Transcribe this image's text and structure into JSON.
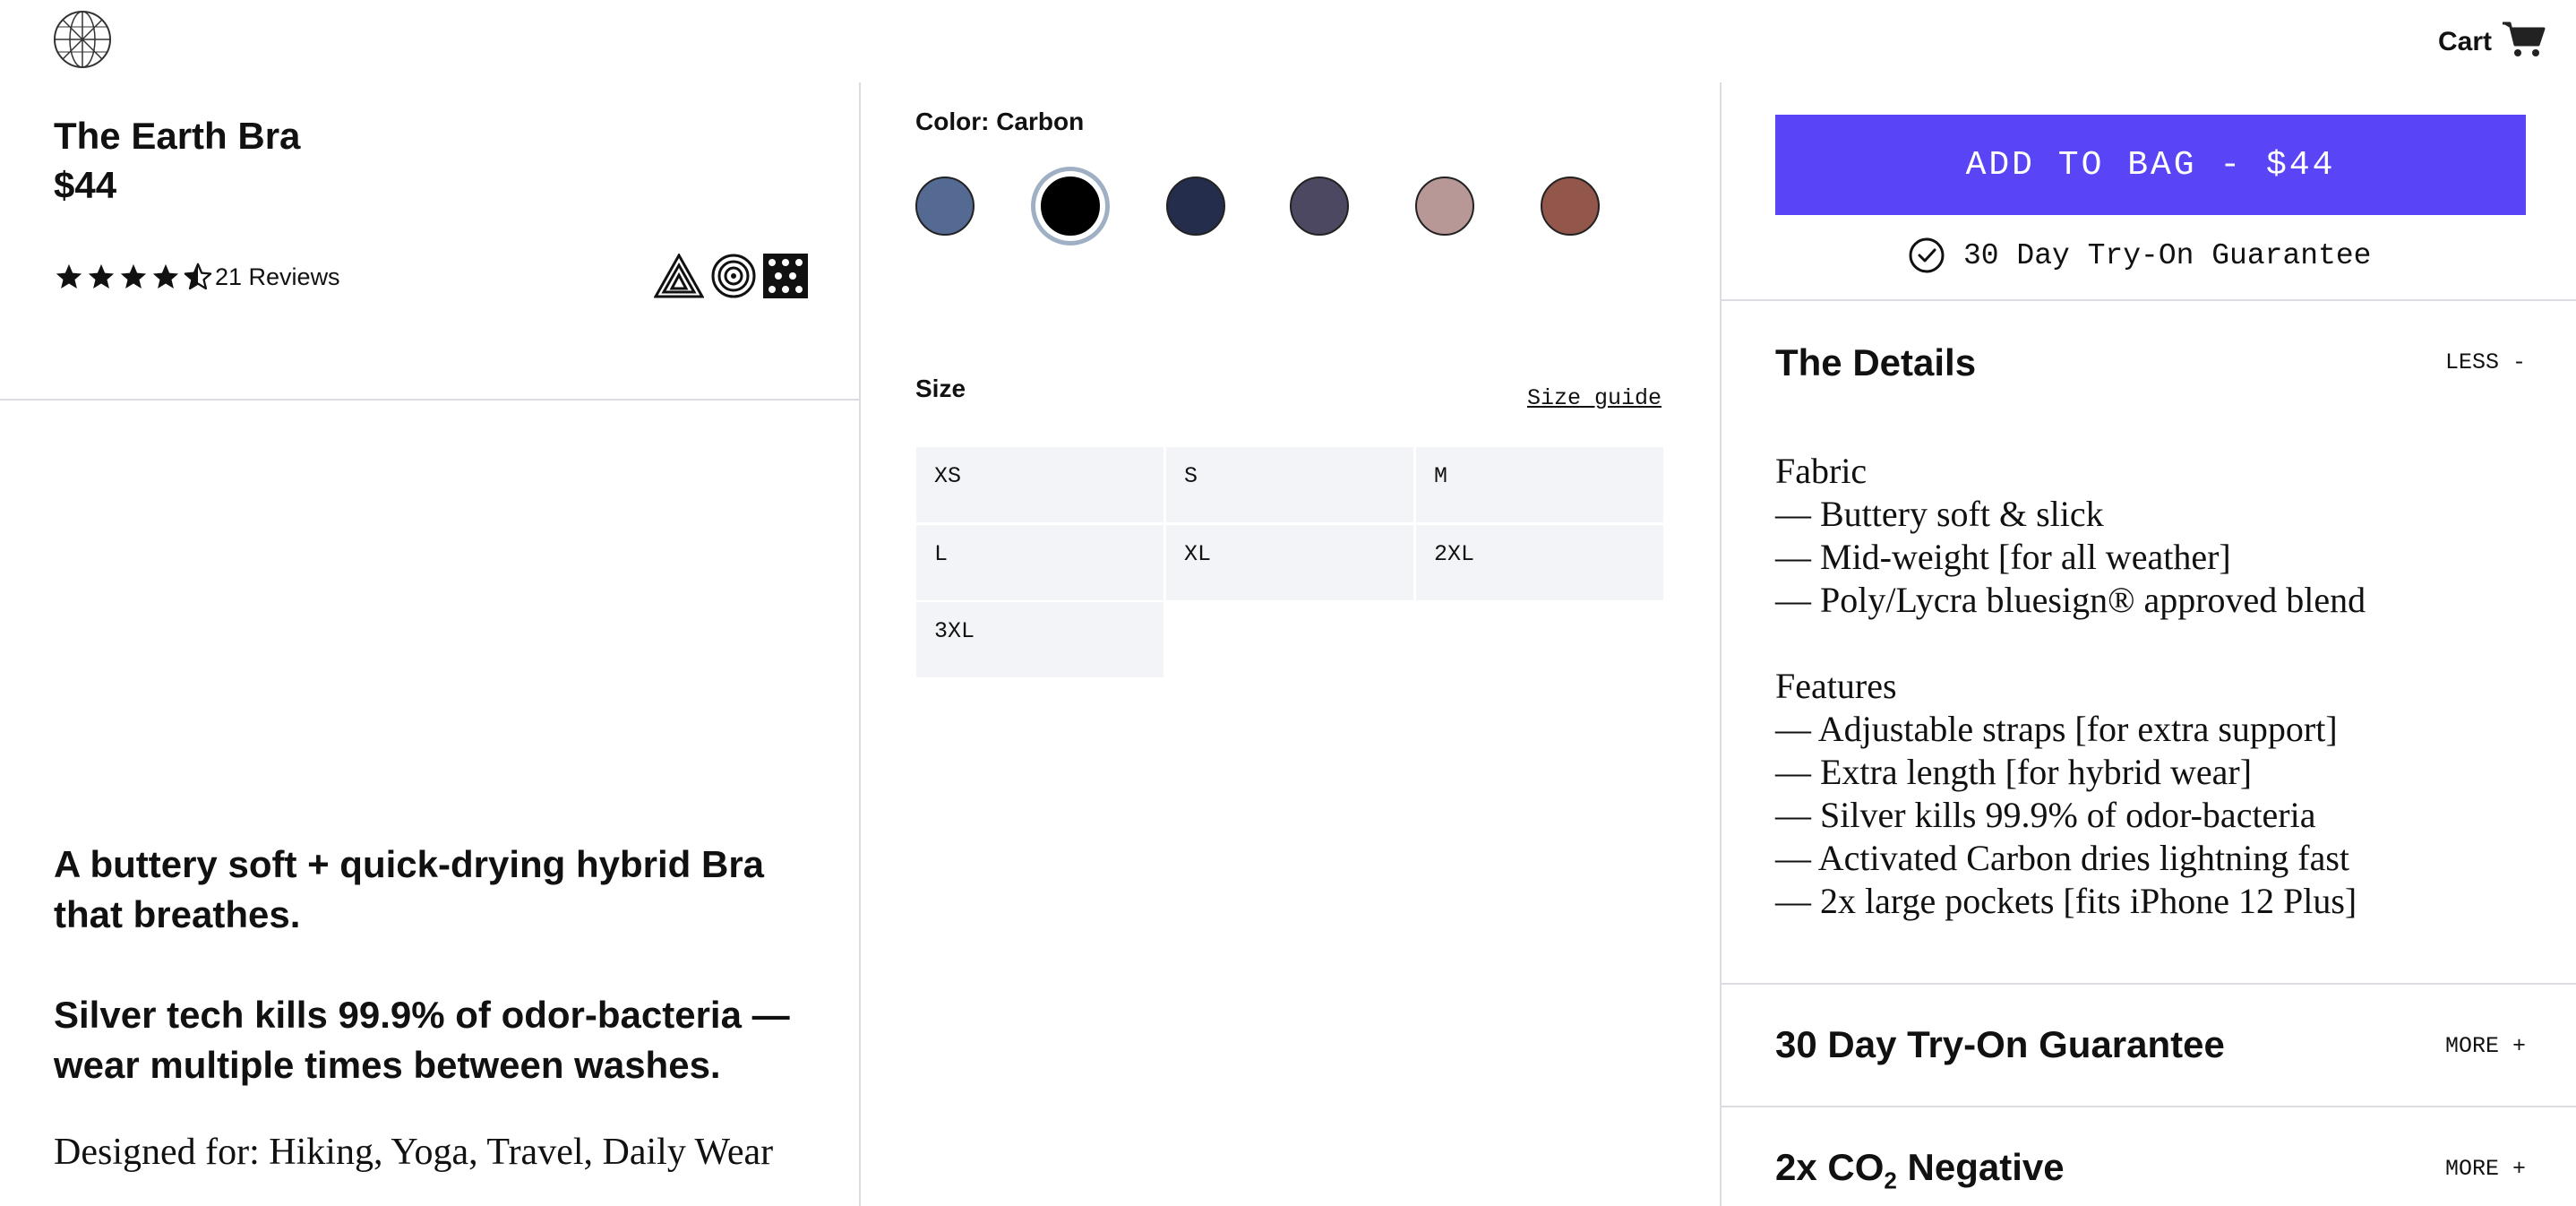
{
  "header": {
    "logo_icon": "globe-logo-icon",
    "cart_label": "Cart",
    "cart_icon": "cart-icon"
  },
  "product": {
    "title": "The Earth Bra",
    "price": "$44",
    "rating": 4.5,
    "reviews": "21 Reviews",
    "badges": [
      "triangle-badge-icon",
      "spiral-badge-icon",
      "dots-badge-icon"
    ],
    "tagline1": "A buttery soft + quick-drying hybrid Bra that breathes.",
    "tagline2": "Silver tech kills 99.9% of odor-bacteria — wear multiple times between washes.",
    "designed_for": "Designed for: Hiking, Yoga, Travel, Daily Wear"
  },
  "color": {
    "label": "Color: Carbon",
    "selected": "Carbon",
    "swatches": [
      "#546a93",
      "#000000",
      "#252d4d",
      "#4c4861",
      "#b79896",
      "#93564a"
    ]
  },
  "size": {
    "label": "Size",
    "guide_link": "Size guide",
    "options": [
      "XS",
      "S",
      "M",
      "L",
      "XL",
      "2XL",
      "3XL"
    ]
  },
  "purchase": {
    "add_to_bag": "ADD TO BAG - $44",
    "guarantee": "30 Day Try-On Guarantee",
    "accent_color": "#5a45f6"
  },
  "details": {
    "title": "The Details",
    "toggle": "LESS -",
    "lines": [
      "Fabric",
      "— Buttery soft & slick",
      "— Mid-weight [for all weather]",
      "— Poly/Lycra bluesign® approved blend",
      "",
      "Features",
      "— Adjustable straps [for extra support]",
      "— Extra length [for hybrid wear]",
      "— Silver kills 99.9% of odor-bacteria",
      "— Activated Carbon dries lightning fast",
      "— 2x large pockets [fits iPhone 12 Plus]"
    ]
  },
  "sections": [
    {
      "title": "30 Day Try-On Guarantee",
      "toggle": "MORE +"
    },
    {
      "title": "2x CO",
      "subscript": "2",
      "title_rest": " Negative",
      "toggle": "MORE +"
    }
  ]
}
